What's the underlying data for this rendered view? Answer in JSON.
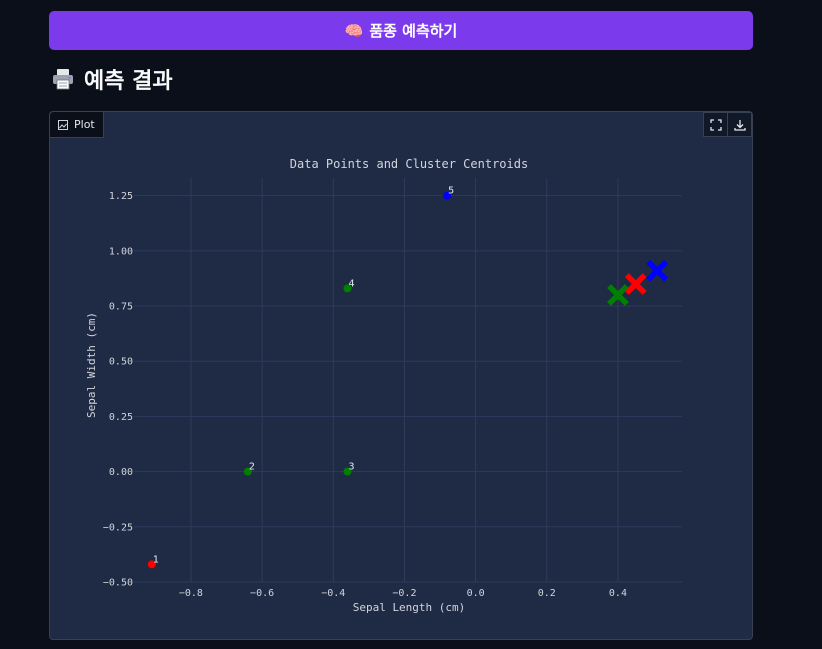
{
  "predict_button": {
    "emoji": "🧠",
    "label": "품종 예측하기"
  },
  "result_section": {
    "title": "예측 결과",
    "icon": "printer-icon"
  },
  "plot_panel": {
    "tab_label": "Plot",
    "tab_icon": "image-icon",
    "tools": [
      "fullscreen-icon",
      "download-icon"
    ]
  },
  "chart_data": {
    "type": "scatter",
    "title": "Data Points and Cluster Centroids",
    "xlabel": "Sepal Length (cm)",
    "ylabel": "Sepal Width (cm)",
    "xlim": [
      -0.96,
      0.58
    ],
    "ylim": [
      -0.5,
      1.33
    ],
    "xticks": [
      -0.8,
      -0.6,
      -0.4,
      -0.2,
      0.0,
      0.2,
      0.4
    ],
    "xtick_labels": [
      "−0.8",
      "−0.6",
      "−0.4",
      "−0.2",
      "0.0",
      "0.2",
      "0.4"
    ],
    "yticks": [
      -0.5,
      -0.25,
      0.0,
      0.25,
      0.5,
      0.75,
      1.0,
      1.25
    ],
    "ytick_labels": [
      "−0.50",
      "−0.25",
      "0.00",
      "0.25",
      "0.50",
      "0.75",
      "1.00",
      "1.25"
    ],
    "grid": true,
    "points": [
      {
        "label": "1",
        "x": -0.91,
        "y": -0.42,
        "color": "#ff0000"
      },
      {
        "label": "2",
        "x": -0.64,
        "y": 0.0,
        "color": "#008000"
      },
      {
        "label": "3",
        "x": -0.36,
        "y": 0.0,
        "color": "#008000"
      },
      {
        "label": "4",
        "x": -0.36,
        "y": 0.83,
        "color": "#008000"
      },
      {
        "label": "5",
        "x": -0.08,
        "y": 1.25,
        "color": "#0000ff"
      }
    ],
    "centroids": [
      {
        "x": 0.4,
        "y": 0.8,
        "color": "#008000"
      },
      {
        "x": 0.45,
        "y": 0.85,
        "color": "#ff0000"
      },
      {
        "x": 0.51,
        "y": 0.91,
        "color": "#0000ff"
      }
    ]
  },
  "colors": {
    "accent": "#7c3aed",
    "panel_bg": "#1f2a44",
    "page_bg": "#0b0f19"
  }
}
